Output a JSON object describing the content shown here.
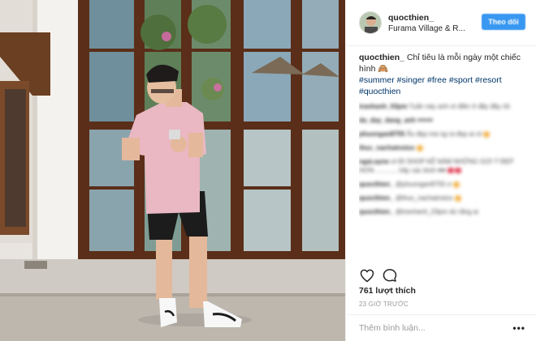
{
  "post": {
    "username": "quocthien_",
    "location": "Furama Village & R...",
    "follow_label": "Theo dõi",
    "caption_user": "quocthien_",
    "caption_text": "Chỉ tiêu là mỗi ngày một chiếc hình 🙈",
    "hashtags": "#summer #singer #free #sport #resort #quocthien",
    "likes": "761 lượt thích",
    "time_ago": "23 GIỜ TRƯỚC",
    "comment_placeholder": "Thêm bình luận...",
    "more_label": "•••"
  },
  "comments": [
    {
      "user": "tranhanh_03pm",
      "text": "Tuấn này anh ơi điền ở đây đây rồi"
    },
    {
      "user": "da_day_dang_anh",
      "text": "♥♥♥♥"
    },
    {
      "user": "phuongan8755",
      "text": "Ấu đẹp mà ng ra đẹp ai ơi"
    },
    {
      "user": "thuc_nachatnstox",
      "text": ""
    },
    {
      "user": "ngai.ayne",
      "text": "ơi ĐI SHOP KẾ NÀM NHỮNG GỢI Ý ĐẸP HƠN ............ hãy các bình ♥♥"
    },
    {
      "user": "quocthien_",
      "text": "@phuongan8755 ơ"
    },
    {
      "user": "quocthien_",
      "text": "@thuc_nachatnstox"
    },
    {
      "user": "quocthien_",
      "text": "@tranhanh_03pm dù rằng ai"
    }
  ],
  "icons": {
    "avatar": "avatar-photo",
    "like": "heart-icon",
    "comment": "comment-bubble-icon",
    "more": "more-options-icon"
  },
  "colors": {
    "follow_button": "#3897f0",
    "hashtag": "#003569",
    "muted": "#999999"
  }
}
